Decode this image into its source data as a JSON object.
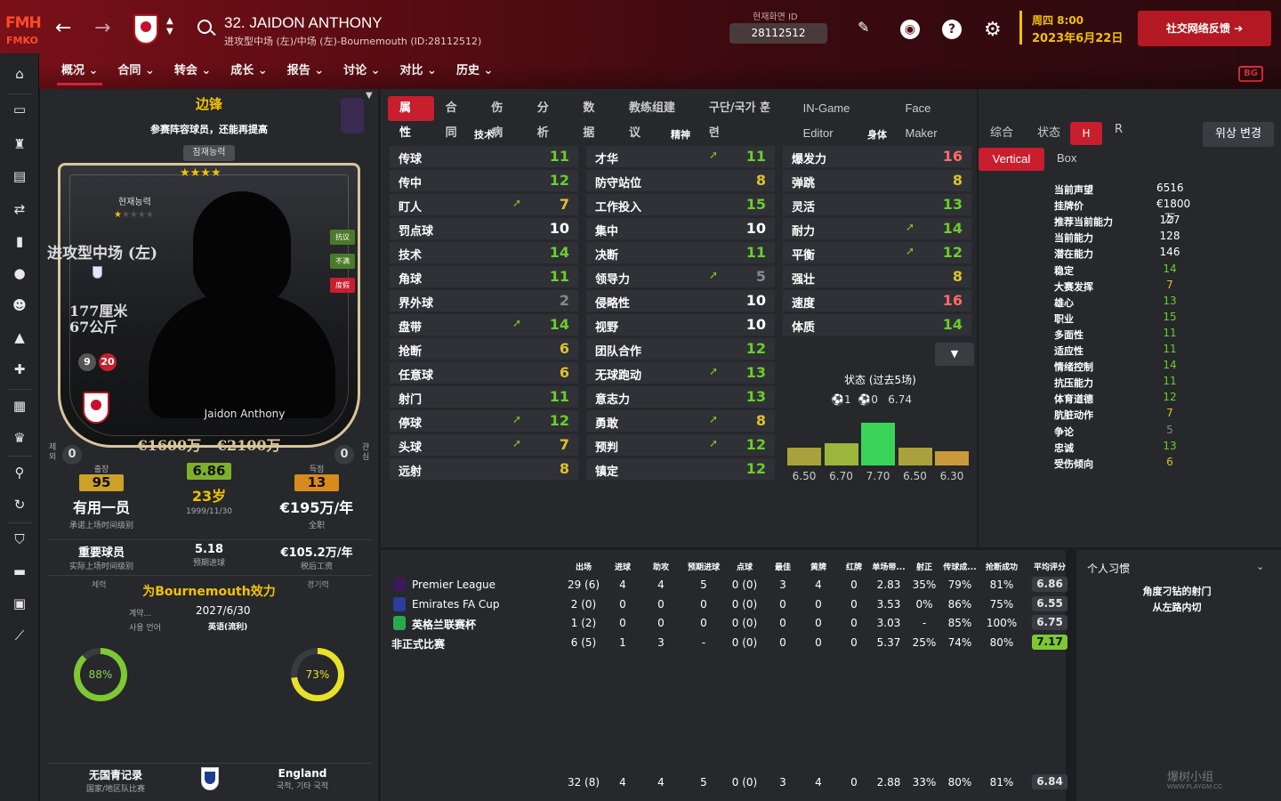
{
  "app": {
    "logo_top": "FMH",
    "logo_bottom": "FMKO"
  },
  "header": {
    "title": "32. JAIDON ANTHONY",
    "subtitle": "进攻型中场 (左)/中场 (左)-Bournemouth (ID:28112512)",
    "id_label": "현재화면 ID",
    "id_value": "28112512",
    "date_day": "周四 8:00",
    "date_full": "2023年6月22日",
    "feedback_label": "社交网络反馈",
    "corner_badge": "BG"
  },
  "nav": [
    {
      "label": "概况 ⌄"
    },
    {
      "label": "合同 ⌄"
    },
    {
      "label": "转会 ⌄"
    },
    {
      "label": "成长 ⌄"
    },
    {
      "label": "报告 ⌄"
    },
    {
      "label": "讨论 ⌄"
    },
    {
      "label": "对比 ⌄"
    },
    {
      "label": "历史 ⌄"
    }
  ],
  "profile": {
    "position_title": "边锋",
    "role_desc": "参赛阵容球员，还能再提高",
    "potential_tab": "잠재능력",
    "potential_stars": "★★★★",
    "current_label": "현재능력",
    "current_stars_on": "★",
    "current_stars_off": "★★★★",
    "card_position": "进攻型中场 (左)",
    "height": "177厘米",
    "weight": "67公斤",
    "num_a": "9",
    "num_b": "20",
    "card_name": "Jaidon Anthony",
    "card_value": "€1600万 - €2100万",
    "tags": [
      "抗议",
      "不满",
      "度假"
    ],
    "left_mini": "제외",
    "right_mini": "관심",
    "left_zero": "0",
    "right_zero": "0",
    "stats": [
      {
        "head": "출장",
        "pill": "95",
        "big": "有用一员",
        "small": "承诺上场时间级别",
        "color": "#c9a227"
      },
      {
        "head": "",
        "pill": "6.86",
        "big": "23岁",
        "small": "1999/11/30",
        "color": "#7fb02a"
      },
      {
        "head": "득점",
        "pill": "13",
        "big": "€195万/年",
        "small": "全职",
        "color": "#d98a1c"
      }
    ],
    "row2": [
      {
        "v": "重要球员",
        "l": "实际上场时间级别"
      },
      {
        "v": "5.18",
        "l": "预期进球"
      },
      {
        "v": "€105.2万/年",
        "l": "税后工资"
      }
    ],
    "eff_left": "체력",
    "eff_right": "경기력",
    "eff_title": "为Bournemouth效力",
    "contract_label": "계약...",
    "contract_value": "2027/6/30",
    "lang_label": "사용 언어",
    "lang_value": "英语(流利)",
    "fitness_pct": "88%",
    "match_pct": "73%",
    "fitness_frac": 0.88,
    "match_frac": 0.73,
    "youth_v": "无国青记录",
    "youth_l": "国家/地区队比赛",
    "nation_v": "England",
    "nation_l": "국적, 기타 국적"
  },
  "tabs": [
    "属性",
    "合同",
    "伤病",
    "分析",
    "数据",
    "教练组建议",
    "구단/국가 훈련",
    "IN-Game Editor",
    "Face Maker"
  ],
  "attributes": {
    "groups": [
      "技术",
      "精神",
      "身体"
    ],
    "technical": [
      {
        "name": "传球",
        "value": "11",
        "arrow": "",
        "color": "#6ccd2a"
      },
      {
        "name": "传中",
        "value": "12",
        "arrow": "",
        "color": "#6ccd2a"
      },
      {
        "name": "盯人",
        "value": "7",
        "arrow": "➚",
        "color": "#e0c22a"
      },
      {
        "name": "罚点球",
        "value": "10",
        "arrow": "",
        "color": "#ffffff"
      },
      {
        "name": "技术",
        "value": "14",
        "arrow": "",
        "color": "#6ccd2a"
      },
      {
        "name": "角球",
        "value": "11",
        "arrow": "",
        "color": "#6ccd2a"
      },
      {
        "name": "界外球",
        "value": "2",
        "arrow": "",
        "color": "#888888"
      },
      {
        "name": "盘带",
        "value": "14",
        "arrow": "➚",
        "color": "#6ccd2a"
      },
      {
        "name": "抢断",
        "value": "6",
        "arrow": "",
        "color": "#e0c22a"
      },
      {
        "name": "任意球",
        "value": "6",
        "arrow": "",
        "color": "#e0c22a"
      },
      {
        "name": "射门",
        "value": "11",
        "arrow": "",
        "color": "#6ccd2a"
      },
      {
        "name": "停球",
        "value": "12",
        "arrow": "➚",
        "color": "#6ccd2a"
      },
      {
        "name": "头球",
        "value": "7",
        "arrow": "➚",
        "color": "#e0c22a"
      },
      {
        "name": "远射",
        "value": "8",
        "arrow": "",
        "color": "#e0c22a"
      }
    ],
    "mental": [
      {
        "name": "才华",
        "value": "11",
        "arrow": "➚",
        "color": "#6ccd2a"
      },
      {
        "name": "防守站位",
        "value": "8",
        "arrow": "",
        "color": "#e0c22a"
      },
      {
        "name": "工作投入",
        "value": "15",
        "arrow": "",
        "color": "#6ccd2a"
      },
      {
        "name": "集中",
        "value": "10",
        "arrow": "",
        "color": "#ffffff"
      },
      {
        "name": "决断",
        "value": "11",
        "arrow": "",
        "color": "#6ccd2a"
      },
      {
        "name": "领导力",
        "value": "5",
        "arrow": "➚",
        "color": "#888888"
      },
      {
        "name": "侵略性",
        "value": "10",
        "arrow": "",
        "color": "#ffffff"
      },
      {
        "name": "视野",
        "value": "10",
        "arrow": "",
        "color": "#ffffff"
      },
      {
        "name": "团队合作",
        "value": "12",
        "arrow": "",
        "color": "#6ccd2a"
      },
      {
        "name": "无球跑动",
        "value": "13",
        "arrow": "➚",
        "color": "#6ccd2a"
      },
      {
        "name": "意志力",
        "value": "13",
        "arrow": "",
        "color": "#6ccd2a"
      },
      {
        "name": "勇敢",
        "value": "8",
        "arrow": "➚",
        "color": "#e0c22a"
      },
      {
        "name": "预判",
        "value": "12",
        "arrow": "➚",
        "color": "#6ccd2a"
      },
      {
        "name": "镇定",
        "value": "12",
        "arrow": "",
        "color": "#6ccd2a"
      }
    ],
    "physical": [
      {
        "name": "爆发力",
        "value": "16",
        "arrow": "",
        "color": "#ff6b6b"
      },
      {
        "name": "弹跳",
        "value": "8",
        "arrow": "",
        "color": "#e0c22a"
      },
      {
        "name": "灵活",
        "value": "13",
        "arrow": "",
        "color": "#6ccd2a"
      },
      {
        "name": "耐力",
        "value": "14",
        "arrow": "➚",
        "color": "#6ccd2a"
      },
      {
        "name": "平衡",
        "value": "12",
        "arrow": "➚",
        "color": "#6ccd2a"
      },
      {
        "name": "强壮",
        "value": "8",
        "arrow": "",
        "color": "#e0c22a"
      },
      {
        "name": "速度",
        "value": "16",
        "arrow": "",
        "color": "#ff6b6b"
      },
      {
        "name": "体质",
        "value": "14",
        "arrow": "",
        "color": "#6ccd2a"
      }
    ],
    "form_title": "状态 (过去5场)",
    "form_goals": "1",
    "form_assists": "0",
    "form_avg": "6.74",
    "form_bars": [
      {
        "label": "6.50",
        "value": 6.5,
        "color": "#a9a23c"
      },
      {
        "label": "6.70",
        "value": 6.7,
        "color": "#9cb53c"
      },
      {
        "label": "7.70",
        "value": 7.7,
        "color": "#3ad45a"
      },
      {
        "label": "6.50",
        "value": 6.5,
        "color": "#a9a23c"
      },
      {
        "label": "6.30",
        "value": 6.3,
        "color": "#c99a3c"
      }
    ]
  },
  "info": {
    "view_tabs": [
      "综合",
      "状态",
      "H",
      "R"
    ],
    "vertical": "Vertical",
    "box": "Box",
    "pos_change": "위상 변경",
    "rows": [
      {
        "k": "当前声望",
        "v": "6516",
        "color": "#ffffff"
      },
      {
        "k": "挂牌价",
        "v": "€1800万",
        "color": "#ffffff"
      },
      {
        "k": "推荐当前能力",
        "v": "127",
        "color": "#ffffff"
      },
      {
        "k": "当前能力",
        "v": "128",
        "color": "#ffffff"
      },
      {
        "k": "潜在能力",
        "v": "146",
        "color": "#ffffff"
      },
      {
        "k": "稳定",
        "v": "14",
        "color": "#6ccd2a"
      },
      {
        "k": "大赛发挥",
        "v": "7",
        "color": "#e0c22a"
      },
      {
        "k": "雄心",
        "v": "13",
        "color": "#6ccd2a"
      },
      {
        "k": "职业",
        "v": "15",
        "color": "#6ccd2a"
      },
      {
        "k": "多面性",
        "v": "11",
        "color": "#6ccd2a"
      },
      {
        "k": "适应性",
        "v": "11",
        "color": "#6ccd2a"
      },
      {
        "k": "情绪控制",
        "v": "14",
        "color": "#6ccd2a"
      },
      {
        "k": "抗压能力",
        "v": "11",
        "color": "#6ccd2a"
      },
      {
        "k": "体育道德",
        "v": "12",
        "color": "#6ccd2a"
      },
      {
        "k": "肮脏动作",
        "v": "7",
        "color": "#e0c22a"
      },
      {
        "k": "争论",
        "v": "5",
        "color": "#888888"
      },
      {
        "k": "忠诚",
        "v": "13",
        "color": "#6ccd2a"
      },
      {
        "k": "受伤倾向",
        "v": "6",
        "color": "#e0c22a"
      }
    ]
  },
  "stats_table": {
    "headers": [
      "出场",
      "进球",
      "助攻",
      "预期进球",
      "点球",
      "最佳",
      "黄牌",
      "红牌",
      "单场带...",
      "射正",
      "传球成...",
      "抢断成功",
      "平均评分"
    ],
    "rows": [
      {
        "comp": "Premier League",
        "icon": "#3d195b",
        "cells": [
          "29 (6)",
          "4",
          "4",
          "5",
          "0 (0)",
          "3",
          "4",
          "0",
          "2.83",
          "35%",
          "79%",
          "81%"
        ],
        "rating": "6.86",
        "rcolor": "#d8d8d8",
        "bold": false
      },
      {
        "comp": "Emirates FA Cup",
        "icon": "#2a3d9c",
        "cells": [
          "2 (0)",
          "0",
          "0",
          "0",
          "0 (0)",
          "0",
          "0",
          "0",
          "3.53",
          "0%",
          "86%",
          "75%"
        ],
        "rating": "6.55",
        "rcolor": "#d8d8d8",
        "bold": false
      },
      {
        "comp": "英格兰联赛杯",
        "icon": "#2aa94c",
        "cells": [
          "1 (2)",
          "0",
          "0",
          "0",
          "0 (0)",
          "0",
          "0",
          "0",
          "3.03",
          "-",
          "85%",
          "100%"
        ],
        "rating": "6.75",
        "rcolor": "#d8d8d8",
        "bold": true
      },
      {
        "comp": "非正式比赛",
        "icon": "",
        "cells": [
          "6 (5)",
          "1",
          "3",
          "-",
          "0 (0)",
          "0",
          "0",
          "0",
          "5.37",
          "25%",
          "74%",
          "80%"
        ],
        "rating": "7.17",
        "rcolor": "#7ec832",
        "bold": true
      }
    ],
    "total": {
      "cells": [
        "32 (8)",
        "4",
        "4",
        "5",
        "0 (0)",
        "3",
        "4",
        "0",
        "2.88",
        "33%",
        "80%",
        "81%"
      ],
      "rating": "6.84"
    }
  },
  "habits": {
    "title": "个人习惯",
    "items": [
      "角度刁钻的射门",
      "从左路内切"
    ]
  },
  "watermark": {
    "main": "爆树小组",
    "sub": "WWW.PLAYGM.CC"
  }
}
